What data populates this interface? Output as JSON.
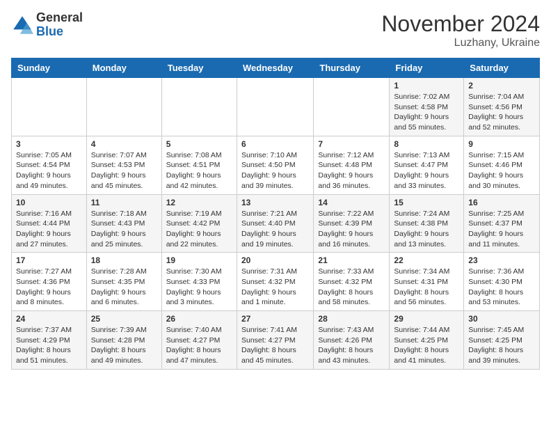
{
  "logo": {
    "general": "General",
    "blue": "Blue"
  },
  "header": {
    "month": "November 2024",
    "location": "Luzhany, Ukraine"
  },
  "weekdays": [
    "Sunday",
    "Monday",
    "Tuesday",
    "Wednesday",
    "Thursday",
    "Friday",
    "Saturday"
  ],
  "weeks": [
    [
      {
        "day": "",
        "info": ""
      },
      {
        "day": "",
        "info": ""
      },
      {
        "day": "",
        "info": ""
      },
      {
        "day": "",
        "info": ""
      },
      {
        "day": "",
        "info": ""
      },
      {
        "day": "1",
        "info": "Sunrise: 7:02 AM\nSunset: 4:58 PM\nDaylight: 9 hours and 55 minutes."
      },
      {
        "day": "2",
        "info": "Sunrise: 7:04 AM\nSunset: 4:56 PM\nDaylight: 9 hours and 52 minutes."
      }
    ],
    [
      {
        "day": "3",
        "info": "Sunrise: 7:05 AM\nSunset: 4:54 PM\nDaylight: 9 hours and 49 minutes."
      },
      {
        "day": "4",
        "info": "Sunrise: 7:07 AM\nSunset: 4:53 PM\nDaylight: 9 hours and 45 minutes."
      },
      {
        "day": "5",
        "info": "Sunrise: 7:08 AM\nSunset: 4:51 PM\nDaylight: 9 hours and 42 minutes."
      },
      {
        "day": "6",
        "info": "Sunrise: 7:10 AM\nSunset: 4:50 PM\nDaylight: 9 hours and 39 minutes."
      },
      {
        "day": "7",
        "info": "Sunrise: 7:12 AM\nSunset: 4:48 PM\nDaylight: 9 hours and 36 minutes."
      },
      {
        "day": "8",
        "info": "Sunrise: 7:13 AM\nSunset: 4:47 PM\nDaylight: 9 hours and 33 minutes."
      },
      {
        "day": "9",
        "info": "Sunrise: 7:15 AM\nSunset: 4:46 PM\nDaylight: 9 hours and 30 minutes."
      }
    ],
    [
      {
        "day": "10",
        "info": "Sunrise: 7:16 AM\nSunset: 4:44 PM\nDaylight: 9 hours and 27 minutes."
      },
      {
        "day": "11",
        "info": "Sunrise: 7:18 AM\nSunset: 4:43 PM\nDaylight: 9 hours and 25 minutes."
      },
      {
        "day": "12",
        "info": "Sunrise: 7:19 AM\nSunset: 4:42 PM\nDaylight: 9 hours and 22 minutes."
      },
      {
        "day": "13",
        "info": "Sunrise: 7:21 AM\nSunset: 4:40 PM\nDaylight: 9 hours and 19 minutes."
      },
      {
        "day": "14",
        "info": "Sunrise: 7:22 AM\nSunset: 4:39 PM\nDaylight: 9 hours and 16 minutes."
      },
      {
        "day": "15",
        "info": "Sunrise: 7:24 AM\nSunset: 4:38 PM\nDaylight: 9 hours and 13 minutes."
      },
      {
        "day": "16",
        "info": "Sunrise: 7:25 AM\nSunset: 4:37 PM\nDaylight: 9 hours and 11 minutes."
      }
    ],
    [
      {
        "day": "17",
        "info": "Sunrise: 7:27 AM\nSunset: 4:36 PM\nDaylight: 9 hours and 8 minutes."
      },
      {
        "day": "18",
        "info": "Sunrise: 7:28 AM\nSunset: 4:35 PM\nDaylight: 9 hours and 6 minutes."
      },
      {
        "day": "19",
        "info": "Sunrise: 7:30 AM\nSunset: 4:33 PM\nDaylight: 9 hours and 3 minutes."
      },
      {
        "day": "20",
        "info": "Sunrise: 7:31 AM\nSunset: 4:32 PM\nDaylight: 9 hours and 1 minute."
      },
      {
        "day": "21",
        "info": "Sunrise: 7:33 AM\nSunset: 4:32 PM\nDaylight: 8 hours and 58 minutes."
      },
      {
        "day": "22",
        "info": "Sunrise: 7:34 AM\nSunset: 4:31 PM\nDaylight: 8 hours and 56 minutes."
      },
      {
        "day": "23",
        "info": "Sunrise: 7:36 AM\nSunset: 4:30 PM\nDaylight: 8 hours and 53 minutes."
      }
    ],
    [
      {
        "day": "24",
        "info": "Sunrise: 7:37 AM\nSunset: 4:29 PM\nDaylight: 8 hours and 51 minutes."
      },
      {
        "day": "25",
        "info": "Sunrise: 7:39 AM\nSunset: 4:28 PM\nDaylight: 8 hours and 49 minutes."
      },
      {
        "day": "26",
        "info": "Sunrise: 7:40 AM\nSunset: 4:27 PM\nDaylight: 8 hours and 47 minutes."
      },
      {
        "day": "27",
        "info": "Sunrise: 7:41 AM\nSunset: 4:27 PM\nDaylight: 8 hours and 45 minutes."
      },
      {
        "day": "28",
        "info": "Sunrise: 7:43 AM\nSunset: 4:26 PM\nDaylight: 8 hours and 43 minutes."
      },
      {
        "day": "29",
        "info": "Sunrise: 7:44 AM\nSunset: 4:25 PM\nDaylight: 8 hours and 41 minutes."
      },
      {
        "day": "30",
        "info": "Sunrise: 7:45 AM\nSunset: 4:25 PM\nDaylight: 8 hours and 39 minutes."
      }
    ]
  ]
}
